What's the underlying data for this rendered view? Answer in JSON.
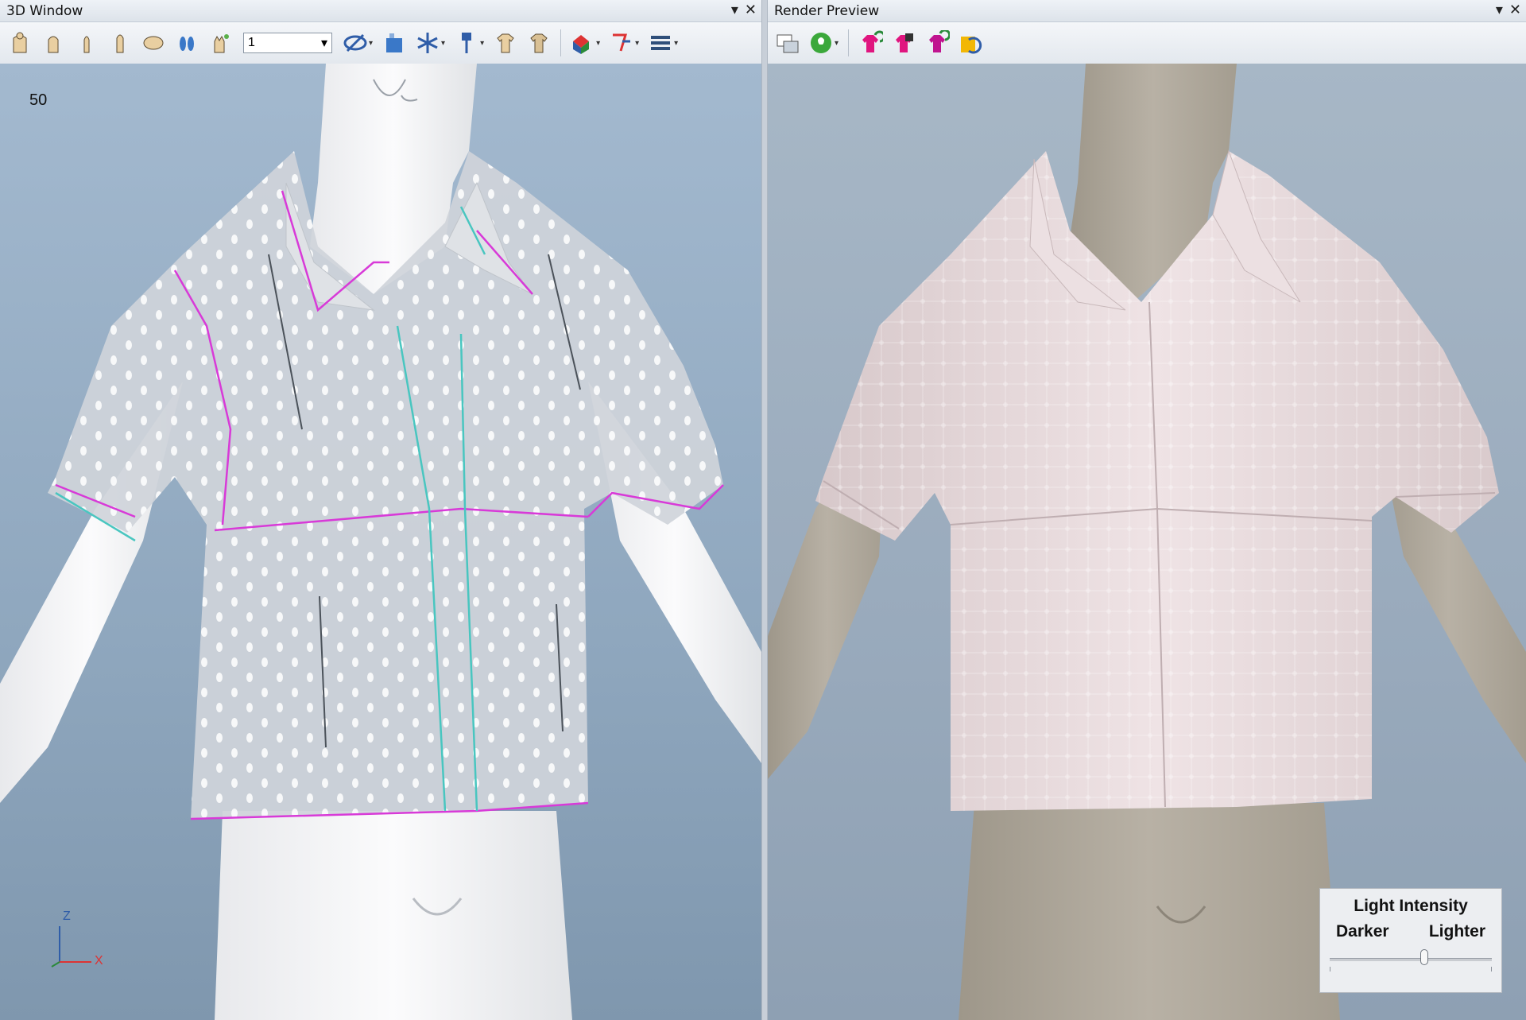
{
  "left_panel": {
    "title": "3D Window",
    "toolbar": {
      "icons": [
        "avatar-front-icon",
        "avatar-torso-icon",
        "avatar-side-icon",
        "avatar-back-icon",
        "avatar-top-icon",
        "avatar-feet-icon",
        "avatar-hand-icon",
        "avatar-rotate-icon",
        "transparency-icon",
        "fabric-icon",
        "freeze-icon",
        "pin-icon",
        "garment-front-icon",
        "garment-back-icon",
        "shape-icon",
        "tape-measure-icon",
        "menu-icon"
      ],
      "combo_value": "1"
    },
    "frame_number": "50",
    "axes": {
      "z": "Z",
      "x": "X"
    }
  },
  "right_panel": {
    "title": "Render Preview",
    "toolbar": {
      "icons": [
        "render-settings-icon",
        "light-bulb-icon",
        "color-front-icon",
        "color-alt-icon",
        "color-back-icon",
        "refresh-render-icon"
      ]
    },
    "light_intensity": {
      "title": "Light Intensity",
      "left_label": "Darker",
      "right_label": "Lighter",
      "value": 0.58
    }
  },
  "colors": {
    "seam_magenta": "#d83ad8",
    "seam_cyan": "#49c6c0",
    "shirt_3d": "#cfd4da",
    "shirt_render": "#e9dcde",
    "avatar_3d": "#f4f4f5",
    "avatar_render": "#b1aa9d"
  }
}
